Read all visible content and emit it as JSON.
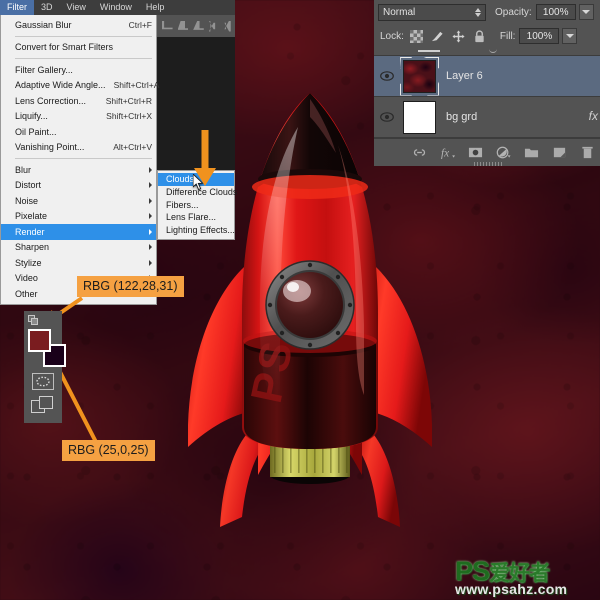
{
  "app": {
    "menubar": [
      {
        "label": "Filter",
        "active": true
      },
      {
        "label": "3D",
        "active": false
      },
      {
        "label": "View",
        "active": false
      },
      {
        "label": "Window",
        "active": false
      },
      {
        "label": "Help",
        "active": false
      }
    ]
  },
  "filter_menu": {
    "items": [
      {
        "label": "Gaussian Blur",
        "shortcut": "Ctrl+F",
        "submenu": false,
        "selected": false,
        "sep_after": true
      },
      {
        "label": "Convert for Smart Filters",
        "shortcut": "",
        "submenu": false,
        "selected": false,
        "sep_after": true
      },
      {
        "label": "Filter Gallery...",
        "shortcut": "",
        "submenu": false,
        "selected": false,
        "sep_after": false
      },
      {
        "label": "Adaptive Wide Angle...",
        "shortcut": "Shift+Ctrl+A",
        "submenu": false,
        "selected": false,
        "sep_after": false
      },
      {
        "label": "Lens Correction...",
        "shortcut": "Shift+Ctrl+R",
        "submenu": false,
        "selected": false,
        "sep_after": false
      },
      {
        "label": "Liquify...",
        "shortcut": "Shift+Ctrl+X",
        "submenu": false,
        "selected": false,
        "sep_after": false
      },
      {
        "label": "Oil Paint...",
        "shortcut": "",
        "submenu": false,
        "selected": false,
        "sep_after": false
      },
      {
        "label": "Vanishing Point...",
        "shortcut": "Alt+Ctrl+V",
        "submenu": false,
        "selected": false,
        "sep_after": true
      },
      {
        "label": "Blur",
        "shortcut": "",
        "submenu": true,
        "selected": false,
        "sep_after": false
      },
      {
        "label": "Distort",
        "shortcut": "",
        "submenu": true,
        "selected": false,
        "sep_after": false
      },
      {
        "label": "Noise",
        "shortcut": "",
        "submenu": true,
        "selected": false,
        "sep_after": false
      },
      {
        "label": "Pixelate",
        "shortcut": "",
        "submenu": true,
        "selected": false,
        "sep_after": false
      },
      {
        "label": "Render",
        "shortcut": "",
        "submenu": true,
        "selected": true,
        "sep_after": false
      },
      {
        "label": "Sharpen",
        "shortcut": "",
        "submenu": true,
        "selected": false,
        "sep_after": false
      },
      {
        "label": "Stylize",
        "shortcut": "",
        "submenu": true,
        "selected": false,
        "sep_after": false
      },
      {
        "label": "Video",
        "shortcut": "",
        "submenu": true,
        "selected": false,
        "sep_after": false
      },
      {
        "label": "Other",
        "shortcut": "",
        "submenu": true,
        "selected": false,
        "sep_after": false
      }
    ]
  },
  "render_submenu": {
    "items": [
      {
        "label": "Clouds",
        "selected": true
      },
      {
        "label": "Difference Clouds",
        "selected": false
      },
      {
        "label": "Fibers...",
        "selected": false
      },
      {
        "label": "Lens Flare...",
        "selected": false
      },
      {
        "label": "Lighting Effects...",
        "selected": false
      }
    ]
  },
  "callouts": [
    {
      "text": "RBG (122,28,31)",
      "target": "foreground-color-swatch"
    },
    {
      "text": "RBG (25,0,25)",
      "target": "background-color-swatch"
    }
  ],
  "tools": {
    "foreground_color": "#7a1c1f",
    "background_color": "#190019",
    "swap_icon": "swap-colors-icon",
    "default_icon": "default-colors-icon",
    "quickmask_icon": "quick-mask-icon",
    "screenmode_icon": "screen-mode-icon"
  },
  "layers_panel": {
    "blend_mode": "Normal",
    "opacity_label": "Opacity:",
    "opacity_value": "100%",
    "lock_label": "Lock:",
    "fill_label": "Fill:",
    "fill_value": "100%",
    "lock_icons": [
      "lock-transparent-pixels-icon",
      "lock-image-pixels-icon",
      "lock-position-icon",
      "lock-all-icon"
    ],
    "layers": [
      {
        "name": "Layer 6",
        "visible": true,
        "selected": true,
        "thumb": "clouds",
        "fx": false
      },
      {
        "name": "bg grd",
        "visible": true,
        "selected": false,
        "thumb": "white",
        "fx": true
      }
    ],
    "footer_icons": [
      "link-layers-icon",
      "layer-style-fx-icon",
      "layer-mask-icon",
      "adjustment-layer-icon",
      "new-group-icon",
      "new-layer-icon",
      "delete-layer-icon"
    ]
  },
  "watermark": {
    "brand": "PS",
    "brand_cn": "爱好者",
    "url": "www.psahz.com"
  },
  "colors": {
    "accent_orange": "#f5a142",
    "menu_highlight": "#2e90e8",
    "panel_bg": "#535353",
    "layer_selected": "#5b6a80",
    "canvas_red": "#4a1018"
  }
}
